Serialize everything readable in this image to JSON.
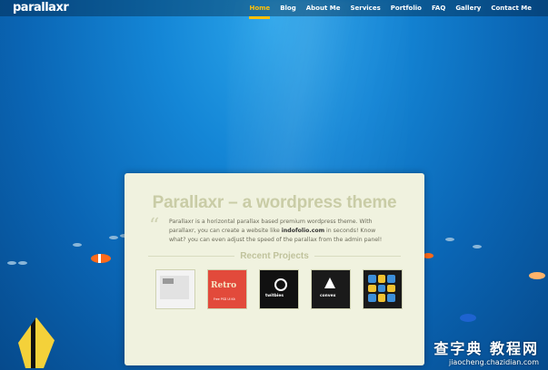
{
  "header": {
    "logo": "parallaxr"
  },
  "nav": {
    "items": [
      {
        "label": "Home",
        "active": true
      },
      {
        "label": "Blog"
      },
      {
        "label": "About Me"
      },
      {
        "label": "Services"
      },
      {
        "label": "Portfolio"
      },
      {
        "label": "FAQ"
      },
      {
        "label": "Gallery"
      },
      {
        "label": "Contact Me"
      }
    ]
  },
  "content": {
    "title": "Parallaxr – a wordpress theme",
    "quote_mark": "“",
    "desc_before": "Parallaxr is a horizontal parallax based premium wordpress theme. With parallaxr, you can create a website like ",
    "desc_link": "indofolio.com",
    "desc_after": " in seconds! Know what? you can even adjust the speed of the parallax from the admin panel!",
    "recent_label": "Recent Projects",
    "projects": [
      {
        "name": "project-1"
      },
      {
        "name": "project-2",
        "word": "Retro",
        "sub": "Free PSD UI Kit"
      },
      {
        "name": "project-3",
        "word": "twitbies"
      },
      {
        "name": "project-4",
        "word": "convex"
      },
      {
        "name": "project-5"
      }
    ]
  },
  "watermark": {
    "big": "查字典 教程网",
    "small": "jiaocheng.chazidian.com"
  },
  "colors": {
    "accent": "#ffc107",
    "card": "#f0f2df",
    "ocean": "#0a65b4"
  }
}
